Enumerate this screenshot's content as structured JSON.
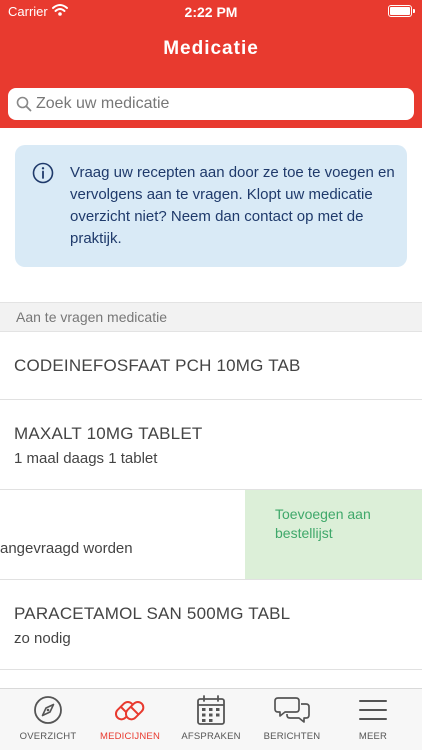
{
  "status_bar": {
    "carrier": "Carrier",
    "time": "2:22 PM"
  },
  "header": {
    "title": "Medicatie"
  },
  "search": {
    "placeholder": "Zoek uw medicatie",
    "value": ""
  },
  "info": {
    "text": "Vraag uw recepten aan door ze toe te voegen en vervolgens aan te vragen. Klopt uw medicatie overzicht niet? Neem dan contact op met de praktijk.",
    "icon": "info-icon"
  },
  "section": {
    "label": "Aan te vragen medicatie"
  },
  "medications": [
    {
      "name": "CODEINEFOSFAAT PCH 10MG TAB",
      "dose": ""
    },
    {
      "name": "MAXALT 10MG TABLET",
      "dose": "1 maal daags 1 tablet"
    },
    {
      "name": "",
      "dose": "angevraagd worden",
      "action_label": "Toevoegen aan bestellijst"
    },
    {
      "name": "PARACETAMOL SAN 500MG TABL",
      "dose": "zo nodig"
    }
  ],
  "tabs": [
    {
      "label": "OVERZICHT",
      "icon": "compass-icon"
    },
    {
      "label": "MEDICIJNEN",
      "icon": "pills-icon",
      "active": true
    },
    {
      "label": "AFSPRAKEN",
      "icon": "calendar-icon"
    },
    {
      "label": "BERICHTEN",
      "icon": "chat-bubbles-icon"
    },
    {
      "label": "MEER",
      "icon": "menu-icon"
    }
  ],
  "colors": {
    "brand": "#e83a2f",
    "info_bg": "#d9eaf6",
    "info_text": "#1f3a6b",
    "swipe_bg": "#dcefd8",
    "swipe_text": "#3fa86a"
  }
}
